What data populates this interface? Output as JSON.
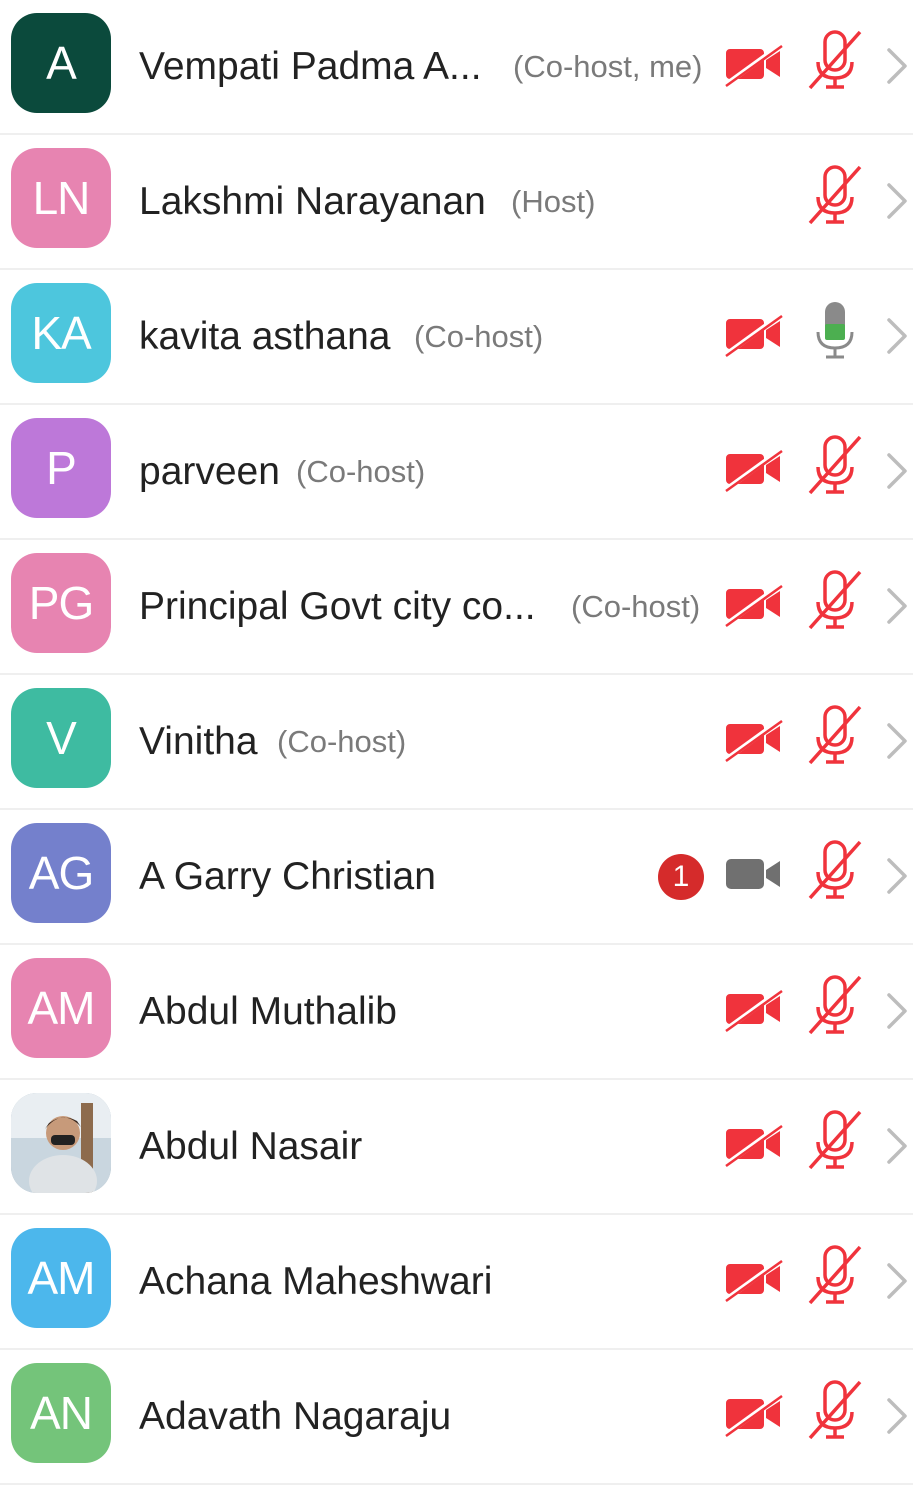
{
  "colors": {
    "muted_red": "#f0333c",
    "unmuted_green": "#4caf50",
    "camera_on_gray": "#707070",
    "chevron_gray": "#bdbdbd"
  },
  "participants": [
    {
      "initials": "A",
      "avatar_color": "#0b4a3c",
      "name": "Vempati Padma A...",
      "role": "(Co-host, me)",
      "video": "off",
      "audio": "muted"
    },
    {
      "initials": "LN",
      "avatar_color": "#e784b1",
      "name": "Lakshmi Narayanan",
      "role": "(Host)",
      "video": "none",
      "audio": "muted"
    },
    {
      "initials": "KA",
      "avatar_color": "#4dc6dd",
      "name": "kavita asthana",
      "role": "(Co-host)",
      "video": "off",
      "audio": "unmuted"
    },
    {
      "initials": "P",
      "avatar_color": "#bd78d9",
      "name": "parveen",
      "role": "(Co-host)",
      "video": "off",
      "audio": "muted"
    },
    {
      "initials": "PG",
      "avatar_color": "#e784b1",
      "name": "Principal Govt city co...",
      "role": "(Co-host)",
      "video": "off",
      "audio": "muted"
    },
    {
      "initials": "V",
      "avatar_color": "#3ebba1",
      "name": "Vinitha",
      "role": "(Co-host)",
      "video": "off",
      "audio": "muted"
    },
    {
      "initials": "AG",
      "avatar_color": "#7480cc",
      "name": "A Garry Christian",
      "role": "",
      "video": "on",
      "audio": "muted",
      "badge": "1"
    },
    {
      "initials": "AM",
      "avatar_color": "#e784b1",
      "name": "Abdul Muthalib",
      "role": "",
      "video": "off",
      "audio": "muted"
    },
    {
      "initials": "",
      "avatar_color": "#9fb0bd",
      "avatar_photo": true,
      "name": "Abdul Nasair",
      "role": "",
      "video": "off",
      "audio": "muted"
    },
    {
      "initials": "AM",
      "avatar_color": "#4cb7ec",
      "name": "Achana Maheshwari",
      "role": "",
      "video": "off",
      "audio": "muted"
    },
    {
      "initials": "AN",
      "avatar_color": "#74c47a",
      "name": "Adavath Nagaraju",
      "role": "",
      "video": "off",
      "audio": "muted"
    }
  ]
}
